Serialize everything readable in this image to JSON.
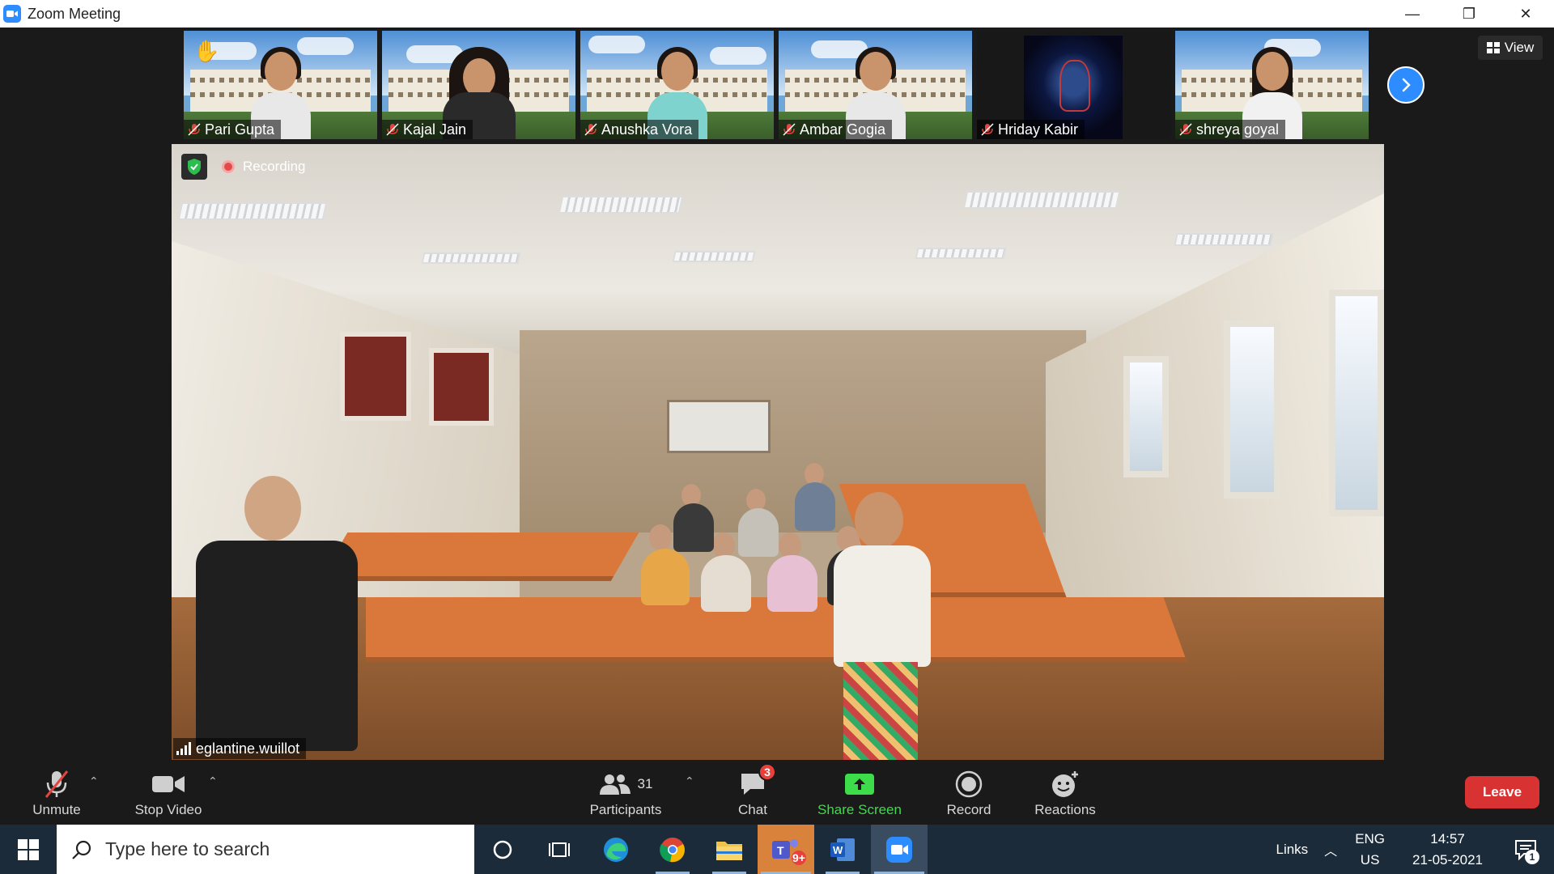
{
  "window": {
    "title": "Zoom Meeting",
    "minimize_glyph": "—",
    "maximize_glyph": "❐",
    "close_glyph": "✕"
  },
  "gallery": {
    "participants": [
      {
        "name": "Pari Gupta",
        "hand_raised": true,
        "muted": true
      },
      {
        "name": "Kajal Jain",
        "muted": true
      },
      {
        "name": "Anushka Vora",
        "muted": true
      },
      {
        "name": "Ambar Gogia",
        "muted": true
      },
      {
        "name": "Hriday Kabir",
        "muted": true
      },
      {
        "name": "shreya goyal",
        "muted": true
      }
    ],
    "next_icon": "chevron-right-icon",
    "view_label": "View"
  },
  "main_video": {
    "recording_label": "Recording",
    "speaker_name": "eglantine.wuillot"
  },
  "toolbar": {
    "unmute_label": "Unmute",
    "stop_video_label": "Stop Video",
    "participants_label": "Participants",
    "participants_count": "31",
    "chat_label": "Chat",
    "chat_badge": "3",
    "share_screen_label": "Share Screen",
    "record_label": "Record",
    "reactions_label": "Reactions",
    "leave_label": "Leave",
    "colors": {
      "accent": "#2D8CFF",
      "share": "#3ddc4a",
      "leave": "#d93232"
    }
  },
  "taskbar": {
    "search_placeholder": "Type here to search",
    "teams_badge": "9+",
    "links_label": "Links",
    "lang_top": "ENG",
    "lang_bottom": "US",
    "time": "14:57",
    "date": "21-05-2021",
    "notification_count": "1"
  }
}
